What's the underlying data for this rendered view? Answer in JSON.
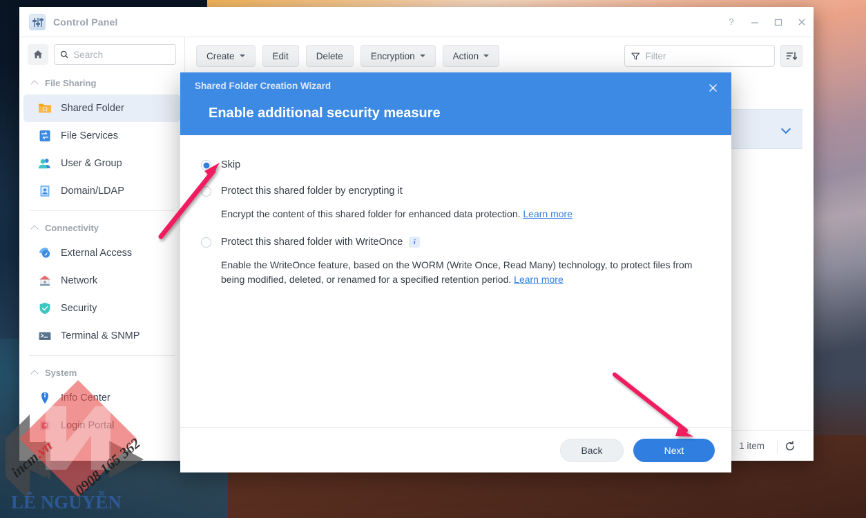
{
  "window": {
    "title": "Control Panel",
    "app_icon": "control-panel-icon",
    "controls": [
      {
        "name": "help",
        "glyph": "?"
      },
      {
        "name": "minimize",
        "glyph": "—"
      },
      {
        "name": "maximize",
        "glyph": "□"
      },
      {
        "name": "close",
        "glyph": "✕"
      }
    ]
  },
  "sidebar": {
    "home_icon": "home-icon",
    "search": {
      "placeholder": "Search",
      "value": "",
      "icon": "search-icon"
    },
    "groups": [
      {
        "title": "File Sharing",
        "collapse_icon": "chevron-up-icon",
        "items": [
          {
            "label": "Shared Folder",
            "icon": "shared-folder-icon",
            "active": true
          },
          {
            "label": "File Services",
            "icon": "file-services-icon",
            "active": false
          },
          {
            "label": "User & Group",
            "icon": "user-group-icon",
            "active": false
          },
          {
            "label": "Domain/LDAP",
            "icon": "domain-ldap-icon",
            "active": false
          }
        ]
      },
      {
        "title": "Connectivity",
        "collapse_icon": "chevron-up-icon",
        "items": [
          {
            "label": "External Access",
            "icon": "external-access-icon",
            "active": false
          },
          {
            "label": "Network",
            "icon": "network-icon",
            "active": false
          },
          {
            "label": "Security",
            "icon": "security-shield-icon",
            "active": false
          },
          {
            "label": "Terminal & SNMP",
            "icon": "terminal-snmp-icon",
            "active": false
          }
        ]
      },
      {
        "title": "System",
        "collapse_icon": "chevron-up-icon",
        "items": [
          {
            "label": "Info Center",
            "icon": "info-center-icon",
            "active": false
          },
          {
            "label": "Login Portal",
            "icon": "login-portal-icon",
            "active": false
          }
        ]
      }
    ]
  },
  "toolbar": {
    "create_label": "Create",
    "edit_label": "Edit",
    "delete_label": "Delete",
    "encryption_label": "Encryption",
    "action_label": "Action",
    "filter": {
      "placeholder": "Filter",
      "value": "",
      "icon": "filter-funnel-icon"
    },
    "sort_icon": "sort-descending-icon"
  },
  "list": {
    "row_expand_icon": "chevron-down-icon"
  },
  "statusbar": {
    "item_count": "1 item",
    "refresh_icon": "refresh-icon"
  },
  "dialog": {
    "subtitle": "Shared Folder Creation Wizard",
    "title": "Enable additional security measure",
    "close_icon": "close-icon",
    "options": [
      {
        "id": "skip",
        "label": "Skip",
        "selected": true,
        "description": null,
        "link": null,
        "info_icon": null
      },
      {
        "id": "encrypt",
        "label": "Protect this shared folder by encrypting it",
        "selected": false,
        "description": "Encrypt the content of this shared folder for enhanced data protection.",
        "link": "Learn more",
        "info_icon": null
      },
      {
        "id": "writeonce",
        "label": "Protect this shared folder with WriteOnce",
        "selected": false,
        "description": "Enable the WriteOnce feature, based on the WORM (Write Once, Read Many) technology, to protect files from being modified, deleted, or renamed for a specified retention period.",
        "link": "Learn more",
        "info_icon": "info-icon"
      }
    ],
    "back_label": "Back",
    "next_label": "Next"
  },
  "watermark": {
    "brand": "LÊ NGUYỄN",
    "site": "incm.vn",
    "phone": "0908 165 362"
  },
  "colors": {
    "accent": "#2f7ee0",
    "dialog_header": "#3d8ae5",
    "active_nav": "#e8eef8",
    "annotation_arrow": "#ef1b5f",
    "watermark_red": "#e03a3a"
  }
}
